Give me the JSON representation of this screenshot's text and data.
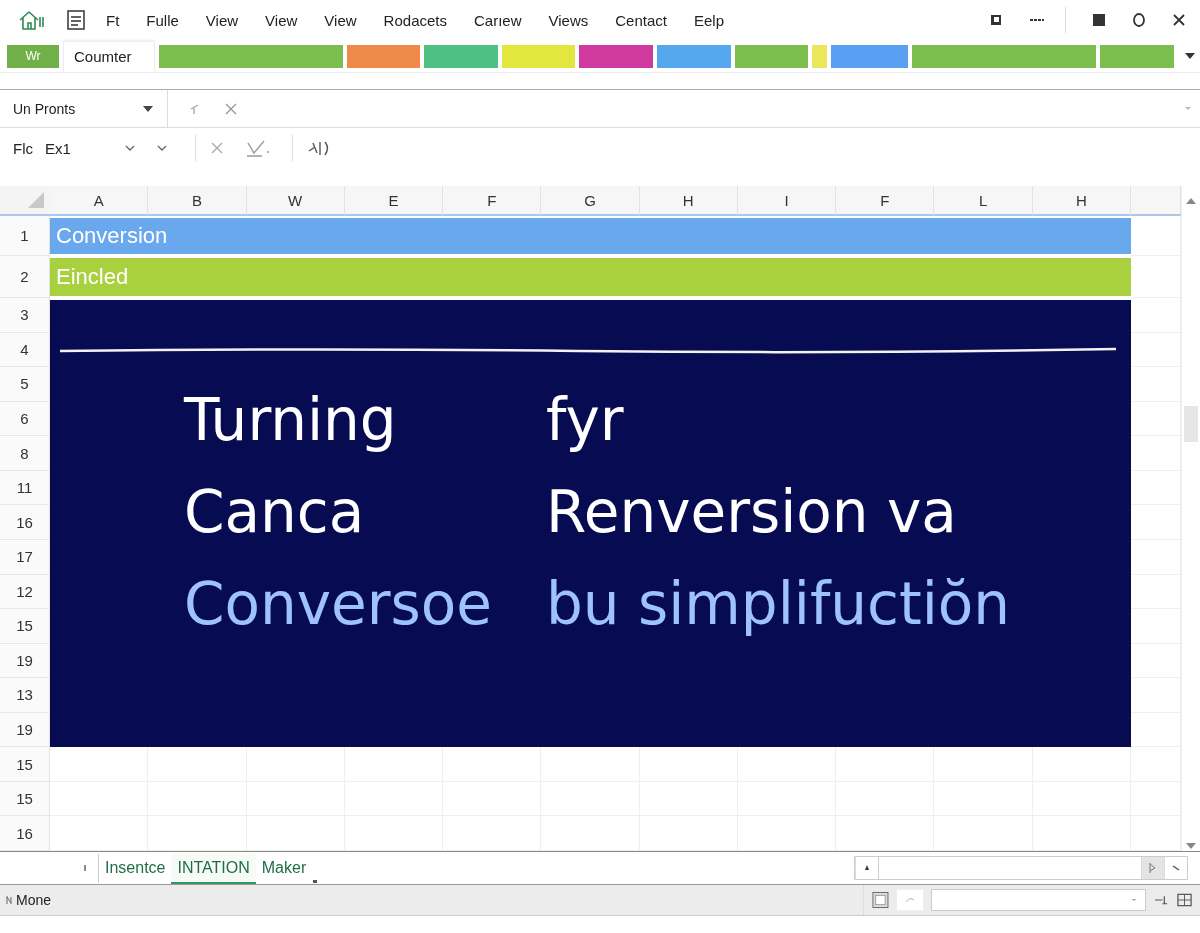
{
  "menu": {
    "items": [
      "Ft",
      "Fulle",
      "View",
      "View",
      "View",
      "Rodacets",
      "Carıew",
      "Views",
      "Centact",
      "Eelp"
    ]
  },
  "ribbon": {
    "badge": "Wr",
    "tab": "Coumter",
    "segments": [
      {
        "color": "#7dbf4e"
      },
      {
        "color": "#f08a4b"
      },
      {
        "color": "#4ec082"
      },
      {
        "color": "#e3e63c"
      },
      {
        "color": "#d0399e"
      },
      {
        "color": "#55a8ee"
      },
      {
        "color": "#7dbf4e"
      },
      {
        "color": "#ece75a"
      },
      {
        "color": "#5aa0f2"
      },
      {
        "color": "#7dbf4e"
      },
      {
        "color": "#7dbf4e"
      }
    ]
  },
  "name_box": {
    "value": "Un Pronts"
  },
  "formula_row": {
    "label": "Flc",
    "value": "Ex1"
  },
  "columns": [
    "A",
    "B",
    "W",
    "E",
    "F",
    "G",
    "H",
    "I",
    "F",
    "L",
    "H"
  ],
  "rows": [
    {
      "number": "1",
      "kind": "banner",
      "text": "Conversion",
      "color": "#6aa8ee"
    },
    {
      "number": "2",
      "kind": "banner",
      "text": "Eincled",
      "color": "#a9d13f"
    },
    {
      "number": "3",
      "kind": "slide"
    },
    {
      "number": "4",
      "kind": "slide"
    },
    {
      "number": "5",
      "kind": "slide"
    },
    {
      "number": "6",
      "kind": "slide"
    },
    {
      "number": "8",
      "kind": "slide"
    },
    {
      "number": "11",
      "kind": "slide"
    },
    {
      "number": "16",
      "kind": "slide"
    },
    {
      "number": "17",
      "kind": "slide"
    },
    {
      "number": "12",
      "kind": "slide"
    },
    {
      "number": "15",
      "kind": "slide"
    },
    {
      "number": "19",
      "kind": "slide"
    },
    {
      "number": "13",
      "kind": "slide"
    },
    {
      "number": "19",
      "kind": "slide"
    },
    {
      "number": "15",
      "kind": "plain"
    },
    {
      "number": "15",
      "kind": "plain"
    },
    {
      "number": "16",
      "kind": "plain"
    }
  ],
  "slide": {
    "lines": [
      {
        "kind": "white",
        "words": [
          "Turning",
          "fyr"
        ]
      },
      {
        "kind": "white",
        "words": [
          "Canca",
          "Renversion va"
        ]
      },
      {
        "kind": "accent",
        "words": [
          "Conversoe",
          "bu simplifuctiŏn"
        ]
      }
    ]
  },
  "sheet_tabs": [
    {
      "label": "Insentce",
      "selected": false
    },
    {
      "label": "INTATION",
      "selected": true
    },
    {
      "label": "Maker",
      "selected": false
    }
  ],
  "status": {
    "text": "Mone"
  }
}
